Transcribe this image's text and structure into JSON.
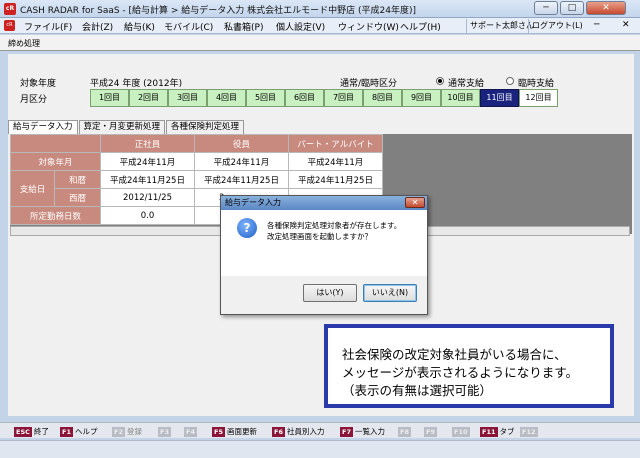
{
  "window": {
    "app_icon": "cR",
    "title": "CASH RADAR for SaaS - [給与計算 > 給与データ入力 株式会社エルモード中野店 (平成24年度)]",
    "min_label": "─",
    "max_label": "□",
    "close_label": "✕"
  },
  "menu": {
    "app_icon": "cR",
    "items": [
      "ファイル(F)",
      "会計(Z)",
      "給与(K)",
      "モバイル(C)",
      "私書箱(P)",
      "個人設定(V)",
      "ウィンドウ(W)",
      "ヘルプ(H)"
    ],
    "support": "サポート太郎さん",
    "logout": "ログアウト(L)",
    "restore_label": "─",
    "close_label": "✕"
  },
  "doc": {
    "title": "締め処理"
  },
  "header": {
    "nendo_label": "対象年度",
    "nendo_value": "平成24 年度 (2012年)",
    "kubun_label": "月区分",
    "tsujo_label": "通常/臨時区分",
    "radio_options": [
      "通常支給",
      "臨時支給"
    ]
  },
  "months": [
    "1回目",
    "2回目",
    "3回目",
    "4回目",
    "5回目",
    "6回目",
    "7回目",
    "8回目",
    "9回目",
    "10回目",
    "11回目",
    "12回目"
  ],
  "tabs": [
    "給与データ入力",
    "算定・月変更新処理",
    "各種保険判定処理"
  ],
  "grid": {
    "columns": [
      "正社員",
      "役員",
      "パート・アルバイト"
    ],
    "rows": {
      "taisho_label": "対象年月",
      "taisho_values": [
        "平成24年11月",
        "平成24年11月",
        "平成24年11月"
      ],
      "shikyu_label": "支給日",
      "wareki_label": "和暦",
      "wareki_values": [
        "平成24年11月25日",
        "平成24年11月25日",
        "平成24年11月25日"
      ],
      "seireki_label": "西暦",
      "seireki_values": [
        "2012/11/25",
        "2"
      ],
      "shotei_label": "所定勤務日数",
      "shotei_values": [
        "0.0"
      ]
    }
  },
  "dialog": {
    "title": "給与データ入力",
    "close_label": "✕",
    "icon_glyph": "?",
    "message1": "各種保険判定処理対象者が存在します。",
    "message2": "改定処理画面を起動しますか？",
    "yes": "はい(Y)",
    "no": "いいえ(N)"
  },
  "note": {
    "line1": "社会保険の改定対象社員がいる場合に、",
    "line2": "メッセージが表示されるようになります。",
    "line3": "（表示の有無は選択可能）"
  },
  "fkeys": [
    {
      "key": "ESC",
      "label": "終了",
      "enabled": true
    },
    {
      "key": "F1",
      "label": "ヘルプ",
      "enabled": true
    },
    {
      "key": "F2",
      "label": "登録",
      "enabled": false
    },
    {
      "key": "F3",
      "label": "",
      "enabled": false
    },
    {
      "key": "F4",
      "label": "",
      "enabled": false
    },
    {
      "key": "F5",
      "label": "画面更新",
      "enabled": true
    },
    {
      "key": "F6",
      "label": "社員別入力",
      "enabled": true
    },
    {
      "key": "F7",
      "label": "一覧入力",
      "enabled": true
    },
    {
      "key": "F8",
      "label": "",
      "enabled": false
    },
    {
      "key": "F9",
      "label": "",
      "enabled": false
    },
    {
      "key": "F10",
      "label": "",
      "enabled": false
    },
    {
      "key": "F11",
      "label": "タブ",
      "enabled": true
    },
    {
      "key": "F12",
      "label": "",
      "enabled": false
    }
  ]
}
